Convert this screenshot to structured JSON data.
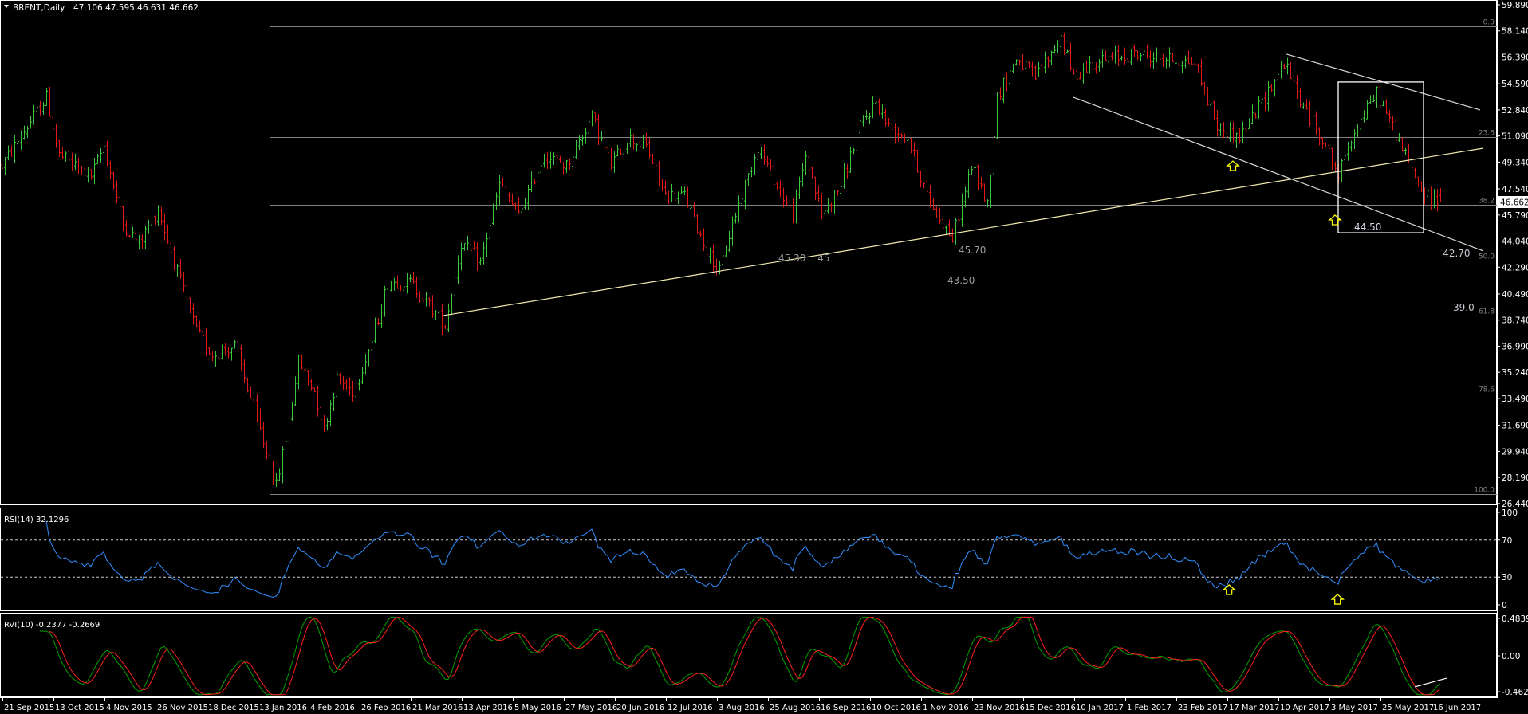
{
  "header": {
    "symbol": "BRENT,Daily",
    "ohlc": "47.106 47.595 46.631 46.662"
  },
  "price_axis": {
    "ticks": [
      "59.890",
      "58.140",
      "56.390",
      "54.590",
      "52.840",
      "51.090",
      "49.340",
      "47.540",
      "45.790",
      "44.040",
      "42.290",
      "40.490",
      "38.740",
      "36.990",
      "35.240",
      "33.490",
      "31.690",
      "29.940",
      "28.190",
      "26.440"
    ],
    "current_price": "46.662"
  },
  "time_axis": {
    "labels": [
      "21 Sep 2015",
      "13 Oct 2015",
      "4 Nov 2015",
      "26 Nov 2015",
      "18 Dec 2015",
      "13 Jan 2016",
      "4 Feb 2016",
      "26 Feb 2016",
      "21 Mar 2016",
      "13 Apr 2016",
      "5 May 2016",
      "27 May 2016",
      "20 Jun 2016",
      "12 Jul 2016",
      "3 Aug 2016",
      "25 Aug 2016",
      "16 Sep 2016",
      "10 Oct 2016",
      "1 Nov 2016",
      "23 Nov 2016",
      "15 Dec 2016",
      "10 Jan 2017",
      "1 Feb 2017",
      "23 Feb 2017",
      "17 Mar 2017",
      "10 Apr 2017",
      "3 May 2017",
      "25 May 2017",
      "16 Jun 2017"
    ],
    "bars_per_label": 16
  },
  "fibonacci": {
    "levels": [
      {
        "label": "0.0",
        "price": 58.45
      },
      {
        "label": "23.6",
        "price": 51.04
      },
      {
        "label": "38.2",
        "price": 46.46
      },
      {
        "label": "50.0",
        "price": 42.76
      },
      {
        "label": "61.8",
        "price": 39.06
      },
      {
        "label": "78.6",
        "price": 33.79
      },
      {
        "label": "100.0",
        "price": 27.07
      }
    ],
    "start_bar": 84
  },
  "annotations": [
    {
      "text": "45.30",
      "bar": 243.5,
      "price": 42.95,
      "color": "#9a9a9a"
    },
    {
      "text": "45",
      "bar": 255.8,
      "price": 42.95,
      "color": "#9a9a9a"
    },
    {
      "text": "45.70",
      "bar": 300,
      "price": 43.48,
      "color": "#9a9a9a"
    },
    {
      "text": "43.50",
      "bar": 296.5,
      "price": 41.45,
      "color": "#9a9a9a"
    },
    {
      "text": "42.70",
      "bar": 451.8,
      "price": 43.27,
      "color": "#c8c8d0"
    },
    {
      "text": "39.0",
      "bar": 455,
      "price": 39.63,
      "color": "#c8c8d0"
    },
    {
      "text": "44.50",
      "bar": 424,
      "price": 45.03,
      "color": "#d8d8e8"
    }
  ],
  "trendlines": [
    {
      "name": "support-trendline",
      "from": [
        138.5,
        39.05
      ],
      "to": [
        464.5,
        50.27
      ],
      "color": "#f2eab0"
    },
    {
      "name": "channel-upper-line",
      "from": [
        402.8,
        56.58
      ],
      "to": [
        463.5,
        52.84
      ],
      "color": "#d8d8d8"
    },
    {
      "name": "channel-lower-line",
      "from": [
        336,
        53.69
      ],
      "to": [
        464.5,
        43.38
      ],
      "color": "#d8d8d8"
    }
  ],
  "box": {
    "bar_from": 419,
    "bar_to": 445.75,
    "price_top": 54.71,
    "price_bottom": 44.6
  },
  "arrows": {
    "price": [
      {
        "bar": 386,
        "price": 49.09
      },
      {
        "bar": 418,
        "price": 45.46
      }
    ],
    "rsi": [
      {
        "bar": 384.8,
        "value": 16.4
      },
      {
        "bar": 418.8,
        "value": 6
      }
    ]
  },
  "rsi": {
    "label": "RSI(14) 32.1296",
    "levels": [
      "100",
      "70",
      "30",
      "0"
    ],
    "color": "#2f8fff"
  },
  "rvi": {
    "label": "RVI(10) -0.2377 -0.2669",
    "ticks": [
      "0.4839",
      "0.00",
      "-0.4622"
    ],
    "main_color": "#00a000",
    "signal_color": "#ff2020",
    "divergence_line": {
      "from": [
        443,
        -0.4
      ],
      "to": [
        453,
        -0.288
      ]
    }
  },
  "colors": {
    "up": "#3cc83c",
    "down": "#e01818",
    "current_price_line": "#3cc83c",
    "fib": "#808080",
    "arrow": "#ffff00"
  },
  "chart_data": {
    "type": "ohlc",
    "symbol": "BRENT",
    "timeframe": "Daily",
    "last_bar": {
      "open": 47.106,
      "high": 47.595,
      "low": 46.631,
      "close": 46.662
    },
    "ylim": [
      26.44,
      59.89
    ],
    "close_path_note": "approximate closes at trading-bar index from 21 Sep 2015",
    "close_path": [
      [
        0,
        49.1
      ],
      [
        14,
        53.7
      ],
      [
        18,
        49.8
      ],
      [
        28,
        48.4
      ],
      [
        32,
        50.4
      ],
      [
        38,
        45.2
      ],
      [
        43,
        43.9
      ],
      [
        49,
        46.2
      ],
      [
        55,
        42.0
      ],
      [
        61,
        38.0
      ],
      [
        66,
        36.4
      ],
      [
        73,
        37.0
      ],
      [
        79,
        32.8
      ],
      [
        86,
        27.6
      ],
      [
        89,
        30.8
      ],
      [
        93,
        36.0
      ],
      [
        98,
        34.0
      ],
      [
        101,
        31.5
      ],
      [
        105,
        34.8
      ],
      [
        110,
        34.0
      ],
      [
        116,
        37.3
      ],
      [
        121,
        41.3
      ],
      [
        128,
        41.3
      ],
      [
        133,
        40.0
      ],
      [
        139,
        38.4
      ],
      [
        144,
        43.9
      ],
      [
        150,
        42.6
      ],
      [
        156,
        47.8
      ],
      [
        162,
        45.8
      ],
      [
        170,
        49.8
      ],
      [
        177,
        49.1
      ],
      [
        185,
        52.4
      ],
      [
        191,
        49.1
      ],
      [
        196,
        51.0
      ],
      [
        202,
        50.4
      ],
      [
        208,
        47.1
      ],
      [
        214,
        47.1
      ],
      [
        220,
        43.9
      ],
      [
        225,
        42.0
      ],
      [
        229,
        45.2
      ],
      [
        237,
        50.4
      ],
      [
        243,
        47.8
      ],
      [
        248,
        45.8
      ],
      [
        252,
        49.8
      ],
      [
        257,
        45.8
      ],
      [
        263,
        47.8
      ],
      [
        269,
        51.7
      ],
      [
        274,
        53.4
      ],
      [
        278,
        51.7
      ],
      [
        284,
        51.0
      ],
      [
        290,
        47.1
      ],
      [
        298,
        44.2
      ],
      [
        304,
        49.1
      ],
      [
        309,
        46.5
      ],
      [
        312,
        53.7
      ],
      [
        318,
        56.3
      ],
      [
        324,
        55.0
      ],
      [
        332,
        57.7
      ],
      [
        336,
        55.0
      ],
      [
        342,
        56.0
      ],
      [
        355,
        56.6
      ],
      [
        364,
        56.3
      ],
      [
        374,
        56.0
      ],
      [
        381,
        51.7
      ],
      [
        388,
        51.0
      ],
      [
        394,
        53.0
      ],
      [
        402,
        56.0
      ],
      [
        408,
        53.0
      ],
      [
        414,
        51.0
      ],
      [
        419,
        48.4
      ],
      [
        423,
        51.0
      ],
      [
        431,
        54.0
      ],
      [
        436,
        51.7
      ],
      [
        440,
        49.8
      ],
      [
        446,
        47.1
      ],
      [
        449,
        46.8
      ],
      [
        451,
        46.662
      ]
    ]
  }
}
